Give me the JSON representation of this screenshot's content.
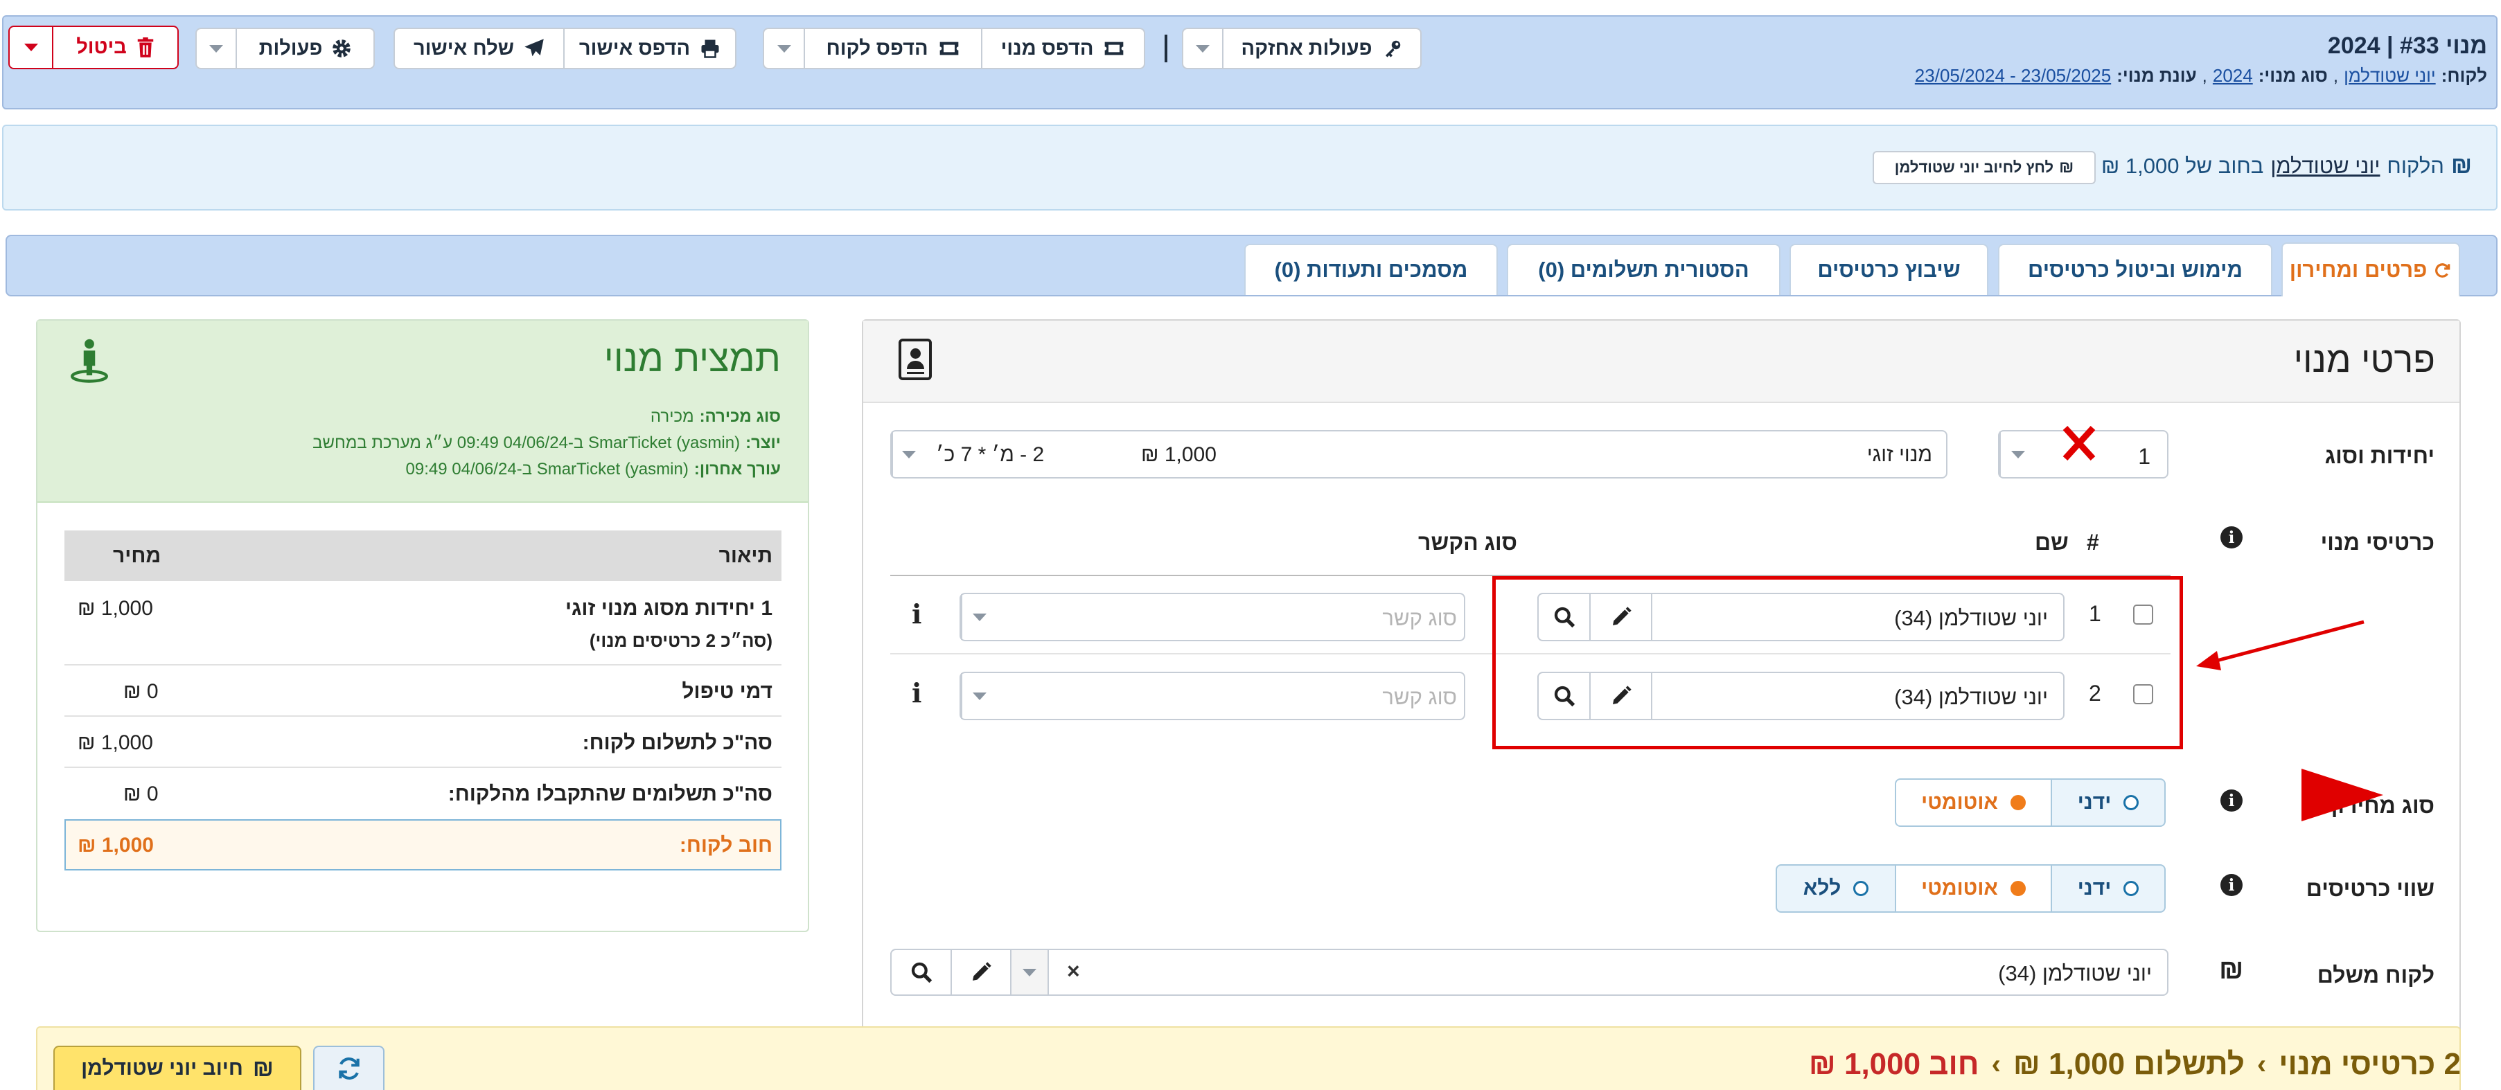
{
  "header": {
    "title": "מנוי #33 | 2024",
    "customer_label": "לקוח:",
    "customer_name": "יוני שטודלמן",
    "type_label": "סוג מנוי:",
    "type_value": "2024",
    "season_label": "עונת מנוי:",
    "season_value": "23/05/2025 - 23/05/2024",
    "buttons": {
      "maintenance": "פעולות אחזקה",
      "print_sub": "הדפס מנוי",
      "print_customer": "הדפס לקוח",
      "print_confirm": "הדפס אישור",
      "send_confirm": "שלח אישור",
      "actions": "פעולות",
      "cancel": "ביטול"
    }
  },
  "alert": {
    "prefix": "הלקוח",
    "name": "יוני שטודלמן",
    "suffix": "בחוב של 1,000 ₪",
    "button": "לחץ לחיוב יוני שטודלמן"
  },
  "tabs": [
    {
      "label": "פרטים ומחירון",
      "active": true
    },
    {
      "label": "מימוש וביטול כרטיסים"
    },
    {
      "label": "שיבוץ כרטיסים"
    },
    {
      "label": "הסטורית תשלומים (0)"
    },
    {
      "label": "מסמכים ותעודות (0)"
    }
  ],
  "details": {
    "title": "פרטי מנוי",
    "units_label": "יחידות וסוג",
    "units_value": "1",
    "package_name": "מנוי זוגי",
    "package_price": "1,000 ₪",
    "package_desc": "2 - מ׳ * 7 כ׳",
    "cards_label": "כרטיסי מנוי",
    "col_num": "#",
    "col_name": "שם",
    "col_relation": "סוג הקשר",
    "cards": [
      {
        "num": "1",
        "name": "יוני שטודלמן (34)",
        "relation_placeholder": "סוג קשר"
      },
      {
        "num": "2",
        "name": "יוני שטודלמן (34)",
        "relation_placeholder": "סוג קשר"
      }
    ],
    "price_type_label": "סוג מחירון",
    "price_type_options": [
      "ידני",
      "אוטומטי"
    ],
    "ticket_value_label": "שווי כרטיסים",
    "ticket_value_options": [
      "ידני",
      "אוטומטי",
      "ללא"
    ],
    "payer_label": "לקוח משלם",
    "payer_name": "יוני שטודלמן (34)"
  },
  "summary": {
    "title": "תמצית מנוי",
    "sale_type_label": "סוג מכירה:",
    "sale_type_value": "מכירה",
    "creator_label": "יוצר:",
    "creator_value": "SmarTicket (yasmin) ב-04/06/24 09:49 ע״ג מערכת במחשב",
    "editor_label": "עורך אחרון:",
    "editor_value": "SmarTicket (yasmin) ב-04/06/24 09:49",
    "table_headers": [
      "תיאור",
      "מחיר"
    ],
    "rows": [
      {
        "desc": "1 יחידות מסוג מנוי זוגי",
        "sub": "(סה״כ 2 כרטיסים מנוי)",
        "price": "1,000 ₪"
      },
      {
        "desc": "דמי טיפול",
        "price": "0 ₪"
      },
      {
        "desc": "סה\"כ לתשלום לקוח:",
        "price": "1,000 ₪"
      },
      {
        "desc": "סה\"כ תשלומים שהתקבלו מהלקוח:",
        "price": "0 ₪"
      }
    ],
    "debt_label": "חוב לקוח:",
    "debt_value": "1,000 ₪"
  },
  "footer": {
    "cards": "2 כרטיסי מנוי",
    "to_pay": "לתשלום 1,000 ₪",
    "debt": "חוב 1,000 ₪",
    "charge_button": "חיוב יוני שטודלמן"
  },
  "colors": {
    "header_bg": "#c5daf5",
    "alert_bg": "#e6f2fb",
    "summary_green": "#2e7d32",
    "orange": "#e0701b",
    "annotation_red": "#e00000"
  }
}
